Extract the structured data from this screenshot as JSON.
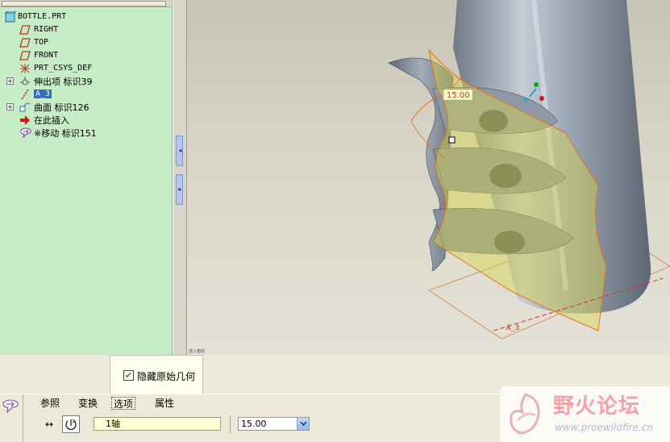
{
  "model_tree": {
    "root": "BOTTLE.PRT",
    "items": [
      {
        "label": "RIGHT",
        "icon": "datum-plane-icon",
        "expandable": false
      },
      {
        "label": "TOP",
        "icon": "datum-plane-icon",
        "expandable": false
      },
      {
        "label": "FRONT",
        "icon": "datum-plane-icon",
        "expandable": false
      },
      {
        "label": "PRT_CSYS_DEF",
        "icon": "coordinate-system-icon",
        "expandable": false
      },
      {
        "label": "伸出项 标识39",
        "icon": "protrusion-icon",
        "expandable": true
      },
      {
        "label": "A_3",
        "icon": "datum-axis-icon",
        "expandable": false,
        "selected": true
      },
      {
        "label": "曲面 标识126",
        "icon": "surface-icon",
        "expandable": true
      },
      {
        "label": "在此插入",
        "icon": "insert-here-arrow-icon",
        "expandable": false
      },
      {
        "label": "※移动 标识151",
        "icon": "move-feature-icon",
        "expandable": false
      }
    ]
  },
  "graphics": {
    "dimension_value": "15.00",
    "axis_label": "A_3",
    "caption": "插入箱体"
  },
  "options_popup": {
    "hide_original_label": "隐藏原始几何",
    "hide_original_checked": true
  },
  "dashboard": {
    "tabs": [
      "参照",
      "变换",
      "选项",
      "属性"
    ],
    "active_tab": "选项",
    "axis_reference": "1轴",
    "angle_value": "15.00"
  },
  "watermark": {
    "title": "野火论坛",
    "url": "www.proewildfire.cn"
  },
  "colors": {
    "tree_background": "#c6ecc6",
    "selection": "#316ac5",
    "surface_preview": "#c8c860",
    "edge_highlight": "#e07020"
  }
}
